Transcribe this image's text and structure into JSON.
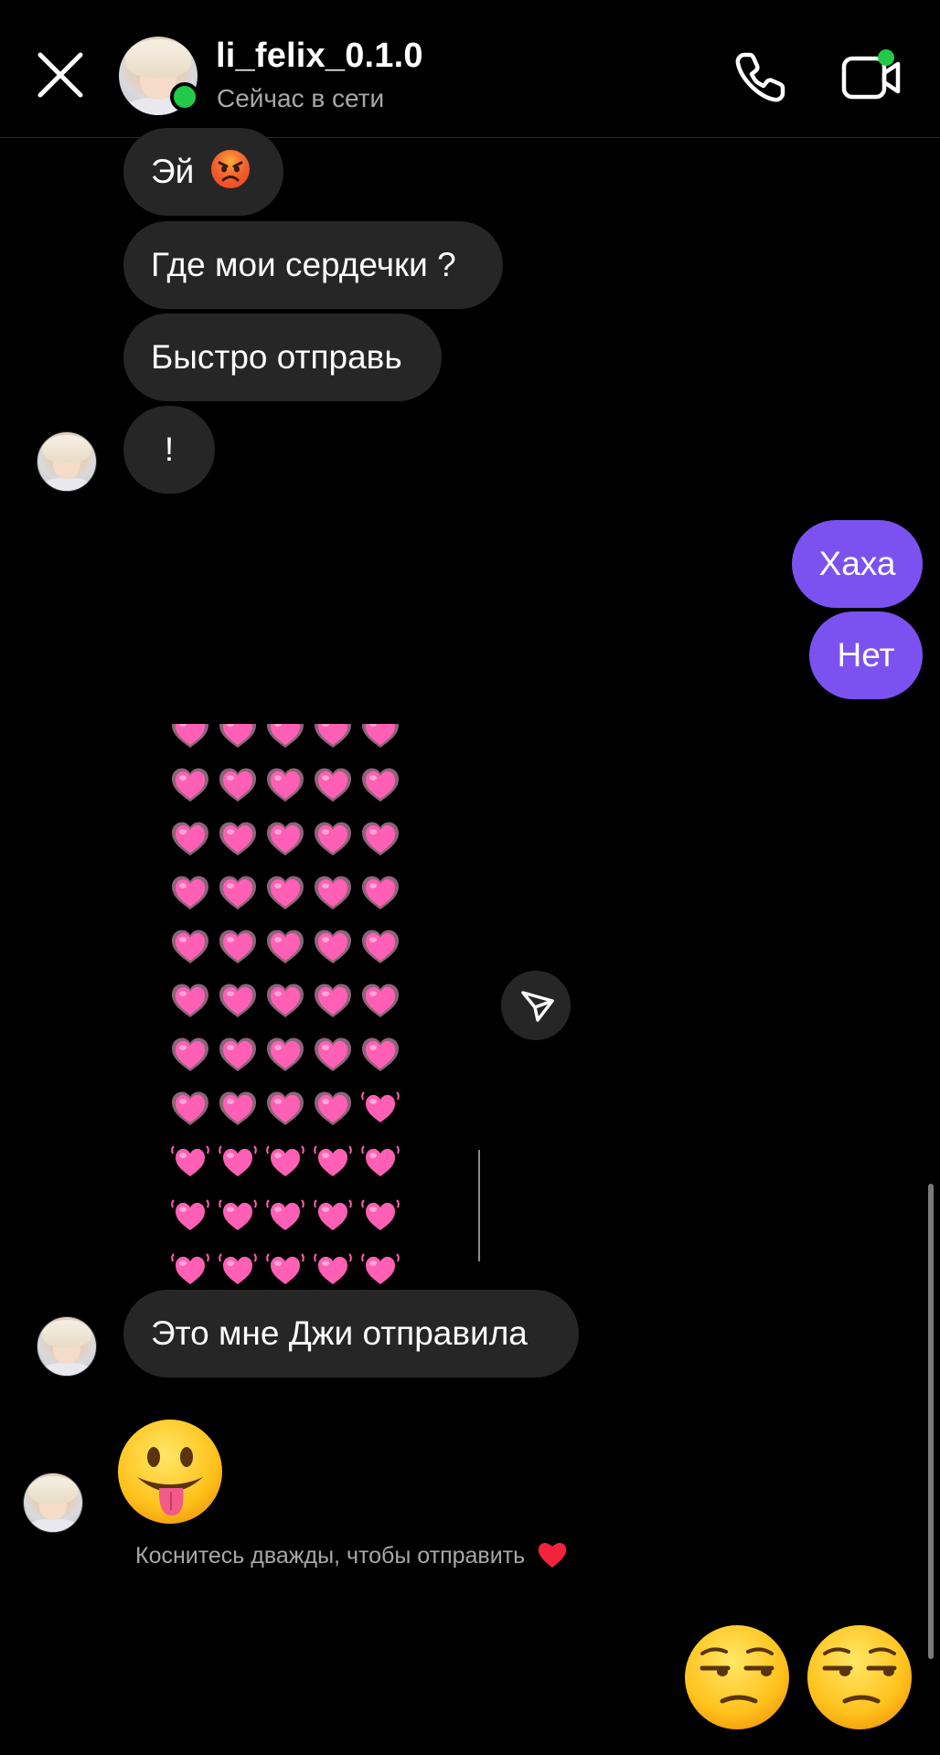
{
  "header": {
    "username": "li_felix_0.1.0",
    "status": "Сейчас в сети"
  },
  "messages": {
    "m1": "Эй",
    "m2": "Где мои сердечки ?",
    "m3": "Быстро отправь",
    "m4": "!",
    "m5": "Хаха",
    "m6": "Нет",
    "m7": "Это мне Джи отправила"
  },
  "hint": "Коснитесь дважды, чтобы отправить",
  "icons": {
    "close": "close-icon",
    "call": "phone-icon",
    "video": "video-call-icon",
    "share": "send-icon",
    "angry": "angry-face-emoji",
    "tongue": "tongue-face-emoji",
    "unamused": "unamused-face-emoji",
    "heart": "red-heart-icon"
  },
  "colors": {
    "background": "#000000",
    "incoming_bubble": "#262626",
    "outgoing_bubble": "#7b52f0",
    "online": "#25c94a",
    "secondary_text": "#a8a8a8",
    "heart": "#ff5fb4"
  }
}
